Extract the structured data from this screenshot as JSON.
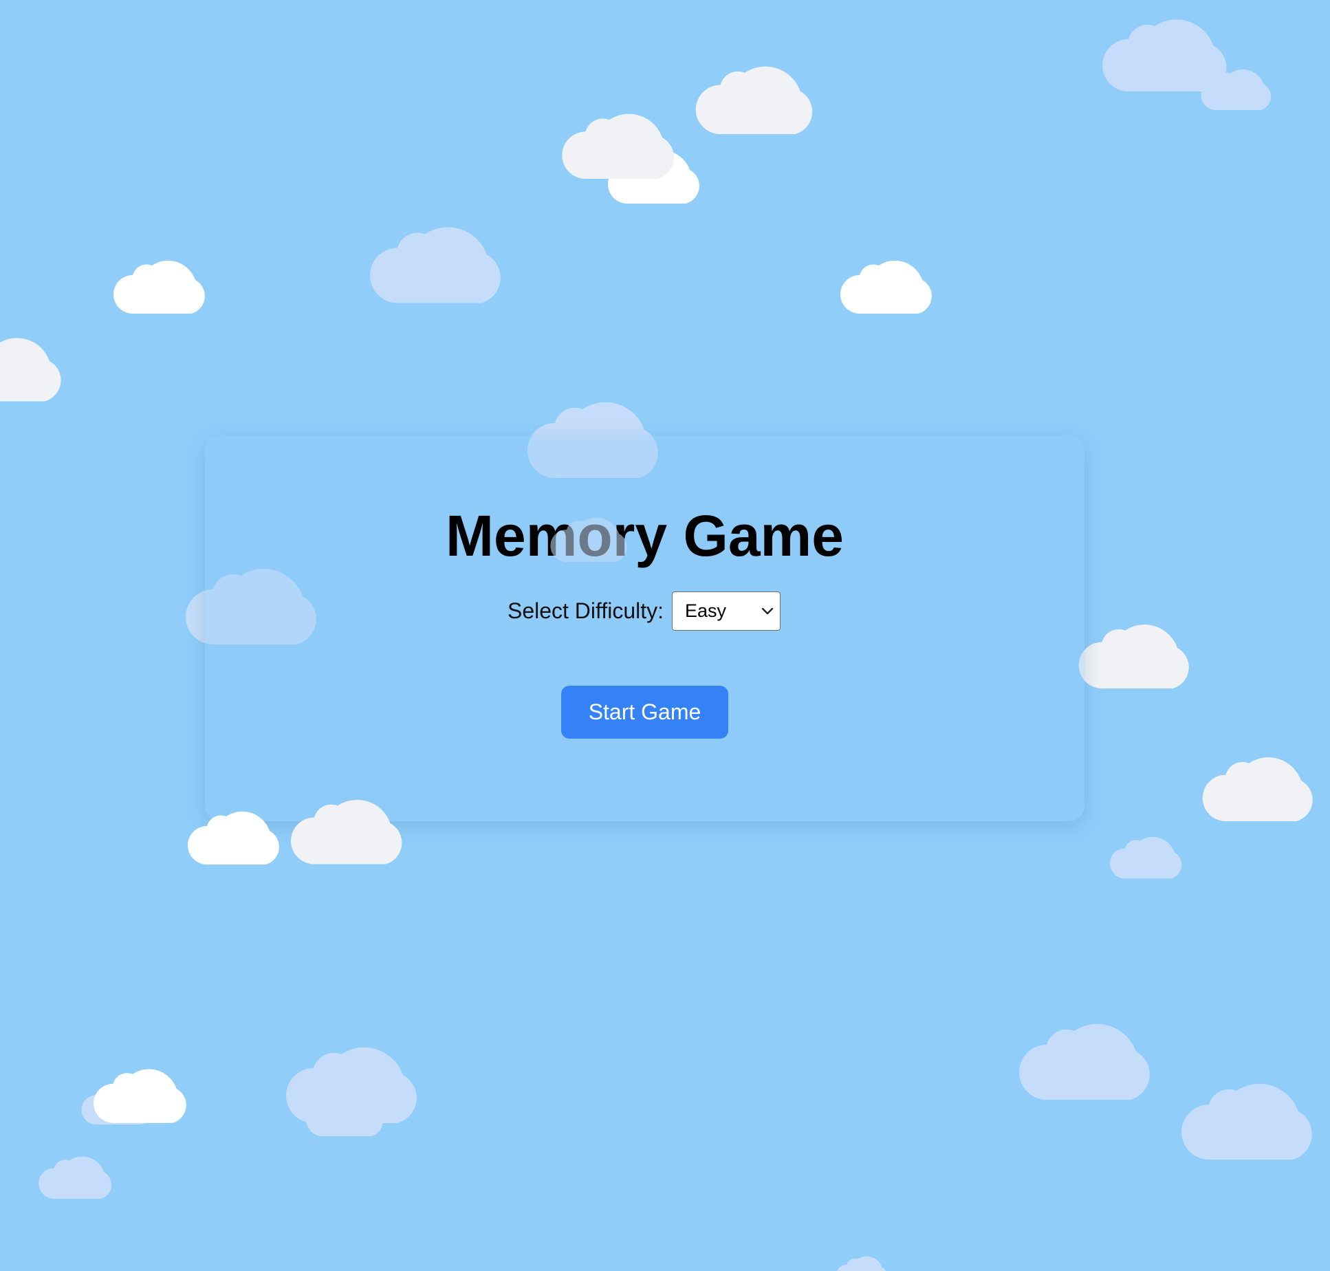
{
  "game": {
    "title": "Memory Game",
    "difficulty_label": "Select Difficulty:",
    "difficulty_selected": "Easy",
    "start_label": "Start Game"
  },
  "background": {
    "sky_color": "#90cdf9",
    "cloud_colors": [
      "#ffffff",
      "#f0f2f5",
      "#c5ddfa"
    ]
  },
  "icons": {
    "select_arrow": "chevron-down-icon",
    "decorations": "cloud-icon"
  }
}
